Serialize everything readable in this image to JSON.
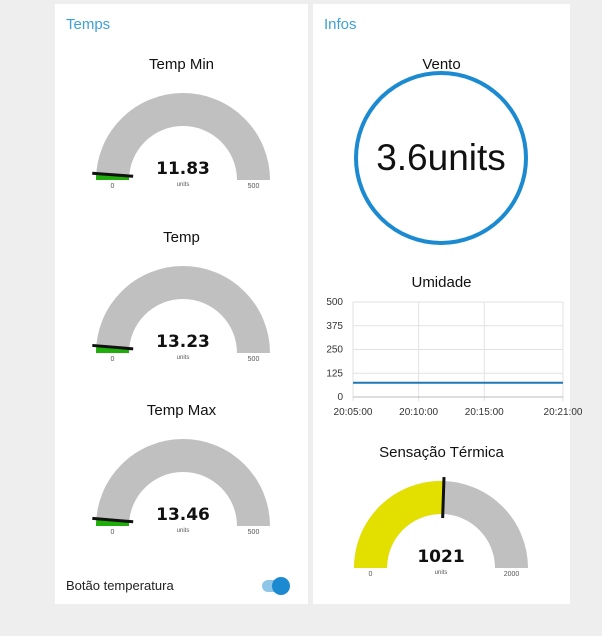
{
  "temps": {
    "title": "Temps",
    "gauges": [
      {
        "title": "Temp Min",
        "value": "11.83",
        "units": "units",
        "min": "0",
        "max": "500",
        "fraction": 0.0237
      },
      {
        "title": "Temp",
        "value": "13.23",
        "units": "units",
        "min": "0",
        "max": "500",
        "fraction": 0.0265
      },
      {
        "title": "Temp Max",
        "value": "13.46",
        "units": "units",
        "min": "0",
        "max": "500",
        "fraction": 0.0269
      }
    ],
    "toggle": {
      "label": "Botão temperatura",
      "on": true
    }
  },
  "infos": {
    "title": "Infos",
    "vento": {
      "title": "Vento",
      "value": "3.6units"
    },
    "umidade": {
      "title": "Umidade"
    },
    "sensacao": {
      "title": "Sensação Térmica",
      "value": "1021",
      "units": "units",
      "min": "0",
      "max": "2000",
      "fraction": 0.5105
    }
  },
  "colors": {
    "accent": "#3ea0d7",
    "gauge_bg": "#c0c0c0",
    "gauge_fill_low": "#1ead0b",
    "gauge_fill_warn": "#e3e000",
    "ring": "#1b8ad0",
    "line": "#1f77b4"
  },
  "chart_data": {
    "type": "line",
    "title": "Umidade",
    "xlabel": "",
    "ylabel": "",
    "x_ticks": [
      "20:05:00",
      "20:10:00",
      "20:15:00",
      "20:21:00"
    ],
    "y_ticks": [
      "0",
      "125",
      "250",
      "375",
      "500"
    ],
    "ylim": [
      0,
      500
    ],
    "xlim": [
      "20:05:00",
      "20:21:00"
    ],
    "grid": true,
    "series": [
      {
        "x": [
          "20:05:00",
          "20:21:00"
        ],
        "y": [
          75,
          75
        ]
      }
    ]
  }
}
